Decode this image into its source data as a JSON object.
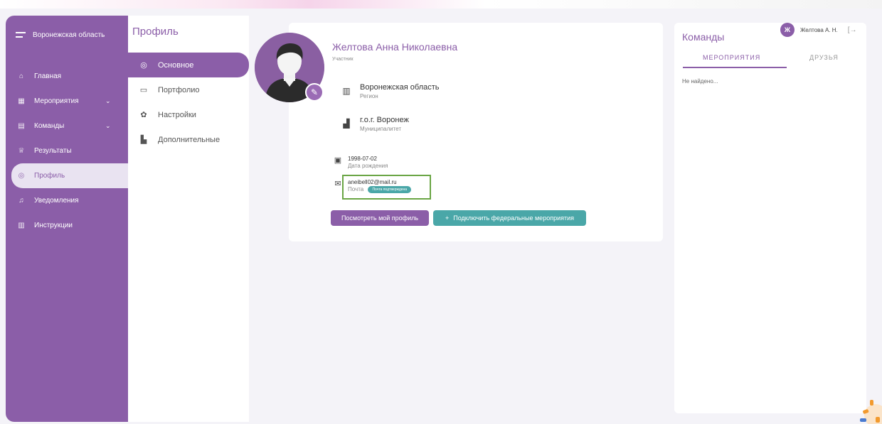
{
  "sidebar": {
    "region": "Воронежская область",
    "items": [
      {
        "label": "Главная",
        "icon": "home-icon",
        "glyph": "⌂"
      },
      {
        "label": "Мероприятия",
        "icon": "calendar-icon",
        "glyph": "▦",
        "chevron": "⌄"
      },
      {
        "label": "Команды",
        "icon": "team-icon",
        "glyph": "▤",
        "chevron": "⌄"
      },
      {
        "label": "Результаты",
        "icon": "trophy-icon",
        "glyph": "♕"
      },
      {
        "label": "Профиль",
        "icon": "profile-icon",
        "glyph": "◎"
      },
      {
        "label": "Уведомления",
        "icon": "bell-icon",
        "glyph": "♫"
      },
      {
        "label": "Инструкции",
        "icon": "book-icon",
        "glyph": "▥"
      }
    ]
  },
  "submenu": {
    "title": "Профиль",
    "items": [
      {
        "label": "Основное",
        "icon": "profile-icon",
        "glyph": "◎"
      },
      {
        "label": "Портфолио",
        "icon": "folder-icon",
        "glyph": "▭"
      },
      {
        "label": "Настройки",
        "icon": "gear-icon",
        "glyph": "✿"
      },
      {
        "label": "Дополнительные",
        "icon": "folder-extra-icon",
        "glyph": "▙"
      }
    ]
  },
  "profile": {
    "name": "Желтова Анна Николаевна",
    "role": "Участник",
    "region_value": "Воронежская область",
    "region_label": "Регион",
    "city_value": "г.о.г. Воронеж",
    "city_label": "Муниципалитет",
    "birth_value": "1998-07-02",
    "birth_label": "Дата рождения",
    "email_value": "aneibell02@mail.ru",
    "email_label": "Почта",
    "email_badge": "Почта подтверждена",
    "view_button": "Посмотреть мой профиль",
    "connect_button": "Подключить федеральные мероприятия",
    "connect_plus": "+"
  },
  "teams": {
    "title": "Команды",
    "tab_events": "МЕРОПРИЯТИЯ",
    "tab_friends": "ДРУЗЬЯ",
    "empty": "Не найдено..."
  },
  "user": {
    "initial": "Ж",
    "name": "Желтова А. Н.",
    "logout_glyph": "[→"
  },
  "colors": {
    "accent": "#8b5ea8",
    "teal": "#4aa7a8",
    "highlight": "#6aa544"
  }
}
